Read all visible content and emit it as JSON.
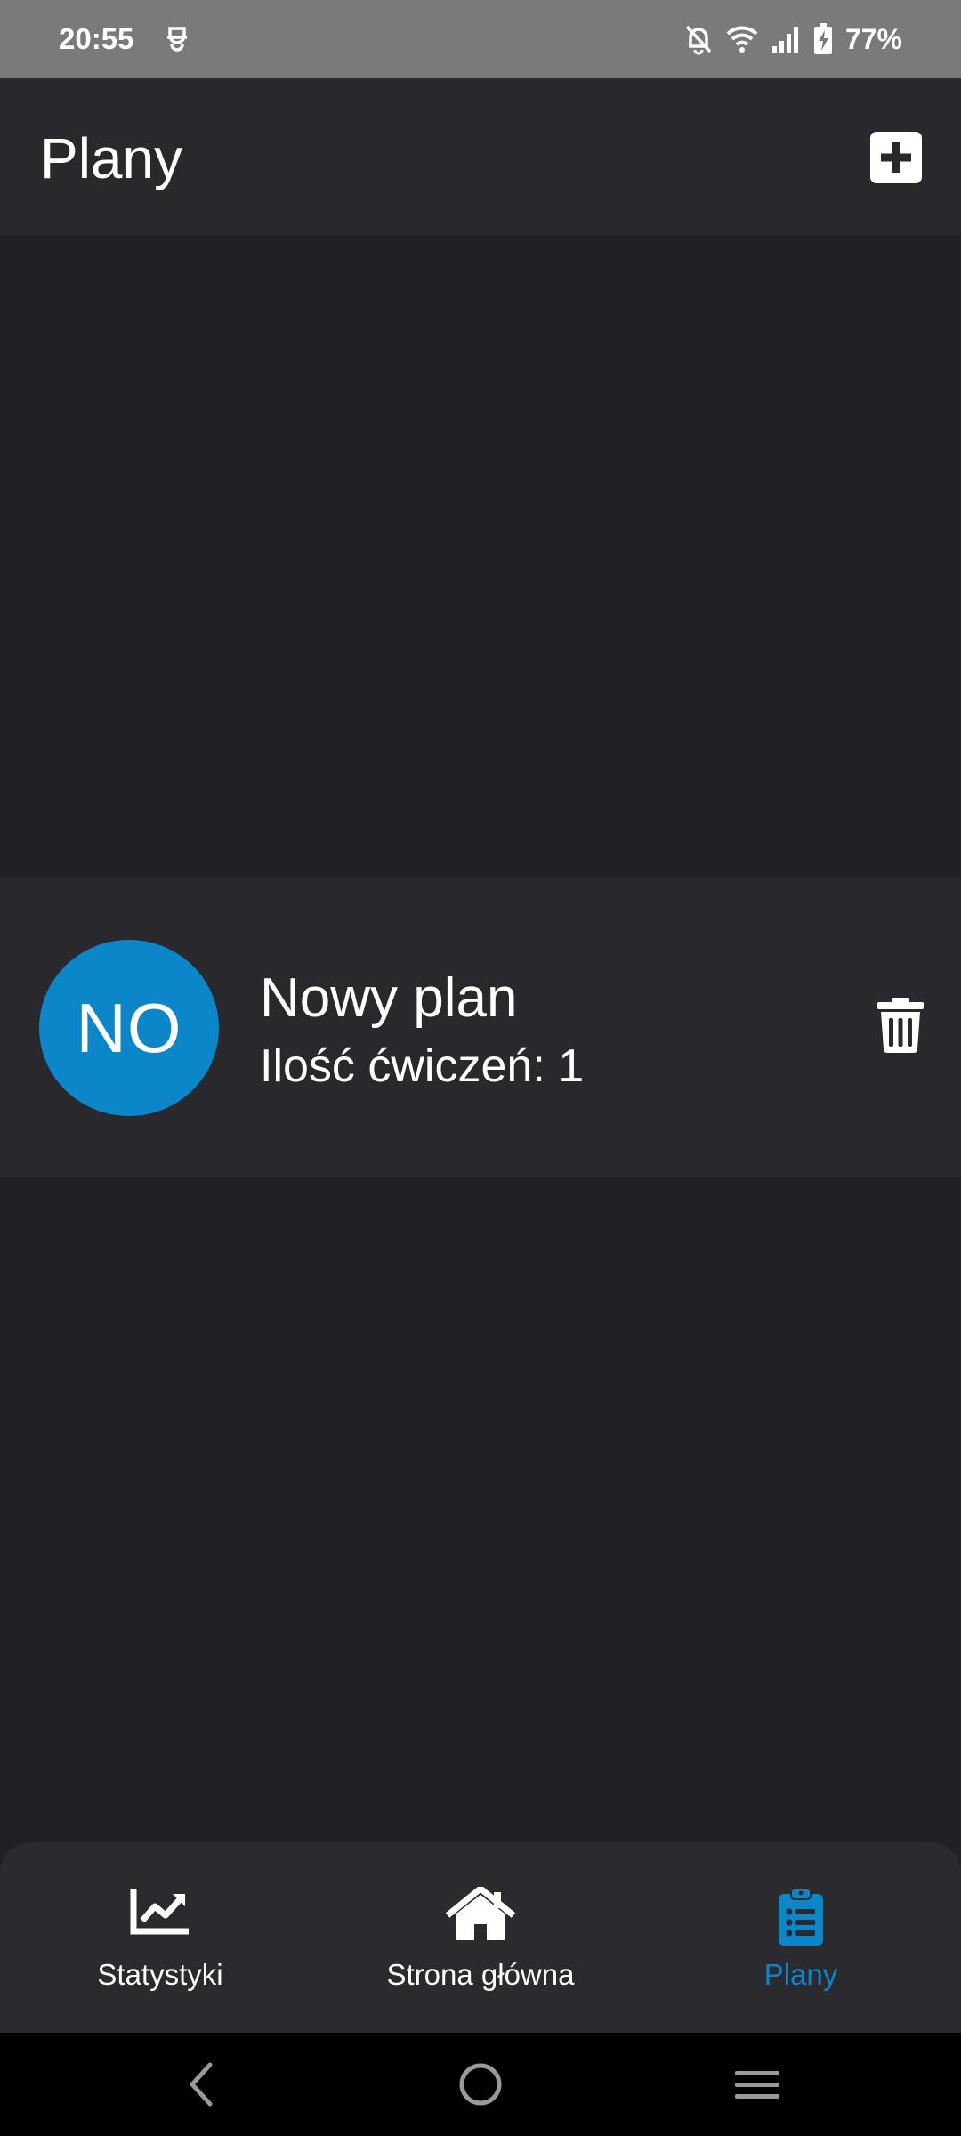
{
  "status_bar": {
    "time": "20:55",
    "battery": "77%",
    "icons": [
      "app-notification-icon",
      "bell-off-icon",
      "wifi-icon",
      "signal-icon",
      "battery-charging-icon"
    ]
  },
  "app_bar": {
    "title": "Plany",
    "add_icon": "plus-square-icon"
  },
  "plans": [
    {
      "avatar": "NO",
      "name": "Nowy plan",
      "exercise_count": "Ilość ćwiczeń: 1",
      "delete_icon": "trash-icon"
    }
  ],
  "bottom_nav": {
    "items": [
      {
        "label": "Statystyki",
        "icon": "chart-line-icon",
        "active": false
      },
      {
        "label": "Strona główna",
        "icon": "home-icon",
        "active": false
      },
      {
        "label": "Plany",
        "icon": "clipboard-list-icon",
        "active": true
      }
    ]
  },
  "system_nav": {
    "icons": [
      "back-icon",
      "home-circle-icon",
      "menu-icon"
    ]
  },
  "colors": {
    "accent": "#0a86c9",
    "background": "#202025",
    "surface": "#28282d",
    "status_bar": "#7a7a7a",
    "text": "#ffffff"
  }
}
